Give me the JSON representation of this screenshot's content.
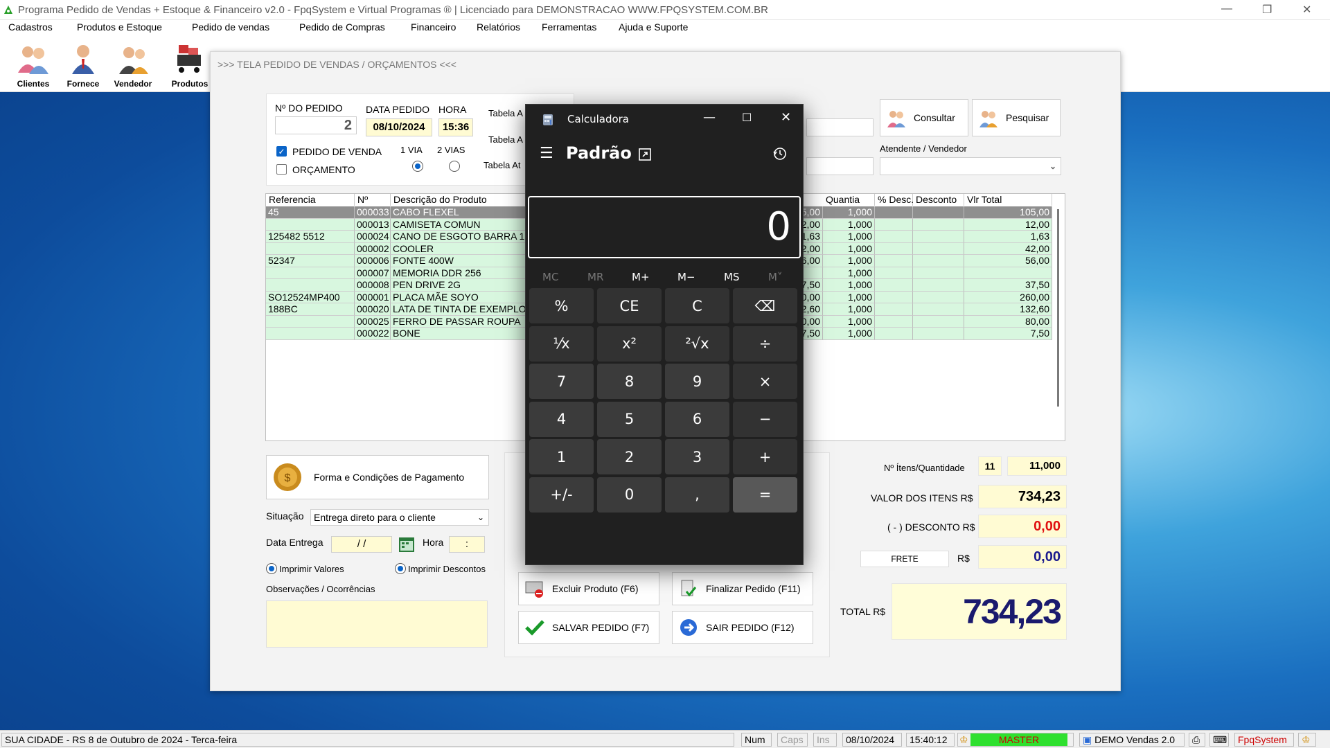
{
  "window": {
    "title": "Programa Pedido de Vendas + Estoque & Financeiro v2.0 - FpqSystem e Virtual Programas ® | Licenciado para  DEMONSTRACAO WWW.FPQSYSTEM.COM.BR"
  },
  "menu": [
    "Cadastros",
    "Produtos e Estoque",
    "Pedido de vendas",
    "Pedido de Compras",
    "Financeiro",
    "Relatórios",
    "Ferramentas",
    "Ajuda e Suporte"
  ],
  "toolbar": [
    "Clientes",
    "Fornece",
    "Vendedor",
    "Produtos"
  ],
  "form": {
    "header": ">>>  TELA PEDIDO DE VENDAS / ORÇAMENTOS  <<<",
    "pedido_label": "Nº DO PEDIDO",
    "pedido_value": "2",
    "data_label": "DATA PEDIDO",
    "data_value": "08/10/2024",
    "hora_label": "HORA",
    "hora_value": "15:36",
    "tabela_a1": "Tabela A",
    "tabela_a2": "Tabela A",
    "tabela_at": "Tabela At",
    "pedido_venda": "PEDIDO DE VENDA",
    "orcamento": "ORÇAMENTO",
    "via1": "1 VIA",
    "vias2": "2 VIAS",
    "consultar": "Consultar",
    "pesquisar": "Pesquisar",
    "atendente_label": "Atendente / Vendedor",
    "pagamento": "Forma e Condições de Pagamento",
    "situacao_label": "Situação",
    "situacao_value": "Entrega direto para o cliente",
    "data_entrega_label": "Data Entrega",
    "data_entrega_value": "  /  /",
    "hora_entrega_label": "Hora",
    "hora_entrega_value": ":",
    "imprimir_valores": "Imprimir Valores",
    "imprimir_descontos": "Imprimir Descontos",
    "obs_label": "Observações / Ocorrências",
    "excluir": "Excluir Produto  (F6)",
    "finalizar": "Finalizar Pedido  (F11)",
    "salvar": "SALVAR PEDIDO (F7)",
    "sair": "SAIR  PEDIDO  (F12)"
  },
  "grid": {
    "columns": [
      "Referencia",
      "Nº",
      "Descrição do Produto",
      "Quantia",
      "% Desc.",
      "Desconto",
      "Vlr Total"
    ],
    "rows": [
      {
        "ref": "45",
        "num": "000033",
        "desc": "CABO FLEXEL",
        "pre": "5,00",
        "qty": "1,000",
        "total": "105,00"
      },
      {
        "ref": "",
        "num": "000013",
        "desc": "CAMISETA COMUN",
        "pre": "2,00",
        "qty": "1,000",
        "total": "12,00"
      },
      {
        "ref": "125482 5512",
        "num": "000024",
        "desc": "CANO DE ESGOTO BARRA 150",
        "pre": "1,63",
        "qty": "1,000",
        "total": "1,63"
      },
      {
        "ref": "",
        "num": "000002",
        "desc": "COOLER",
        "pre": "2,00",
        "qty": "1,000",
        "total": "42,00"
      },
      {
        "ref": "52347",
        "num": "000006",
        "desc": "FONTE 400W",
        "pre": "6,00",
        "qty": "1,000",
        "total": "56,00"
      },
      {
        "ref": "",
        "num": "000007",
        "desc": "MEMORIA DDR 256",
        "pre": "",
        "qty": "1,000",
        "total": ""
      },
      {
        "ref": "",
        "num": "000008",
        "desc": "PEN DRIVE 2G",
        "pre": "7,50",
        "qty": "1,000",
        "total": "37,50"
      },
      {
        "ref": "SO12524MP400",
        "num": "000001",
        "desc": "PLACA MÃE SOYO",
        "pre": "0,00",
        "qty": "1,000",
        "total": "260,00"
      },
      {
        "ref": "188BC",
        "num": "000020",
        "desc": "LATA DE TINTA DE EXEMPLO",
        "pre": "2,60",
        "qty": "1,000",
        "total": "132,60"
      },
      {
        "ref": "",
        "num": "000025",
        "desc": "FERRO DE PASSAR ROUPA",
        "pre": "0,00",
        "qty": "1,000",
        "total": "80,00"
      },
      {
        "ref": "",
        "num": "000022",
        "desc": "BONE",
        "pre": "7,50",
        "qty": "1,000",
        "total": "7,50"
      }
    ]
  },
  "totals": {
    "itens_label": "Nº Ítens/Quantidade",
    "itens_count": "11",
    "itens_qty": "11,000",
    "valor_label": "VALOR DOS ITENS R$",
    "valor": "734,23",
    "desconto_label": "( - ) DESCONTO R$",
    "desconto": "0,00",
    "frete_label": "FRETE",
    "frete_currency": "R$",
    "frete": "0,00",
    "total_label": "TOTAL R$",
    "total": "734,23"
  },
  "calculator": {
    "title": "Calculadora",
    "mode": "Padrão",
    "display": "0",
    "memory": [
      "MC",
      "MR",
      "M+",
      "M−",
      "MS",
      "M˅"
    ],
    "keys": [
      "%",
      "CE",
      "C",
      "⌫",
      "¹⁄x",
      "x²",
      "²√x",
      "÷",
      "7",
      "8",
      "9",
      "×",
      "4",
      "5",
      "6",
      "−",
      "1",
      "2",
      "3",
      "+",
      "+/-",
      "0",
      ",",
      "="
    ]
  },
  "status": {
    "city": "SUA CIDADE - RS  8 de Outubro de 2024 - Terca-feira",
    "num": "Num",
    "caps": "Caps",
    "ins": "Ins",
    "date": "08/10/2024",
    "time": "15:40:12",
    "user": "MASTER",
    "demo": "DEMO Vendas 2.0",
    "brand": "FpqSystem"
  },
  "colors": {
    "grid_row": "#d8f7df",
    "selected_row": "#8f8f8f",
    "total_text": "#1a1a6e",
    "discount_text": "#e01010",
    "status_green": "#2fe02f"
  }
}
